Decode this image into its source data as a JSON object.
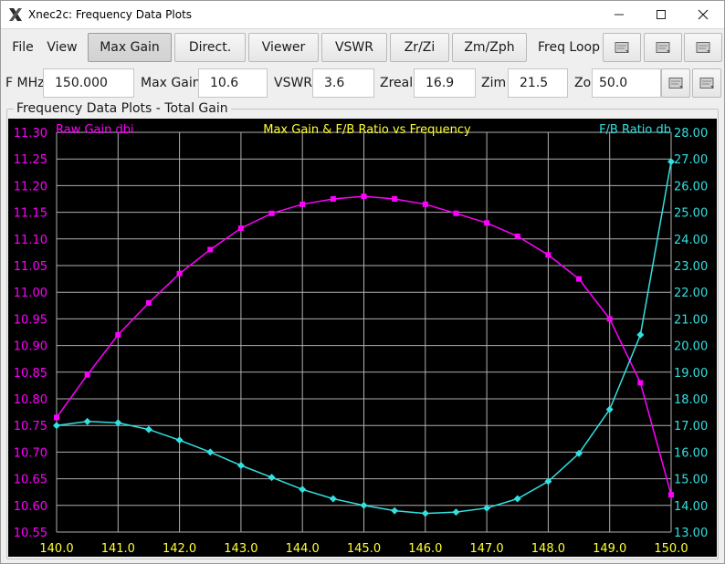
{
  "window": {
    "title": "Xnec2c: Frequency Data Plots"
  },
  "toolbar": {
    "file_label": "File",
    "view_label": "View",
    "max_gain_label": "Max Gain",
    "direct_label": "Direct.",
    "viewer_label": "Viewer",
    "vswr_label": "VSWR",
    "zrzi_label": "Zr/Zi",
    "zmzph_label": "Zm/Zph",
    "freq_loop_label": "Freq Loop"
  },
  "fields": {
    "fmhz_label": "F MHz",
    "fmhz_value": "150.000",
    "maxgain_label": "Max Gain",
    "maxgain_value": "10.6",
    "vswr_label": "VSWR",
    "vswr_value": "3.6",
    "zreal_label": "Zreal",
    "zreal_value": "16.9",
    "zim_label": "Zim",
    "zim_value": "21.5",
    "zo_label": "Zo",
    "zo_value": "50.0"
  },
  "group": {
    "label": "Frequency Data Plots - Total Gain"
  },
  "colors": {
    "gain": "#ff00ff",
    "ratio": "#33e0e0",
    "title": "#ffff33",
    "grid": "#b0b0b0",
    "xticks": "#ffff33"
  },
  "chart_data": {
    "type": "line",
    "title": "Max Gain & F/B Ratio vs Frequency",
    "xlim": [
      140.0,
      150.0
    ],
    "x_ticks": [
      "140.0",
      "141.0",
      "142.0",
      "143.0",
      "144.0",
      "145.0",
      "146.0",
      "147.0",
      "148.0",
      "149.0",
      "150.0"
    ],
    "y_left": {
      "label": "Raw Gain dbi",
      "ylim": [
        10.55,
        11.3
      ],
      "ticks": [
        "11.30",
        "11.25",
        "11.20",
        "11.15",
        "11.10",
        "11.05",
        "11.00",
        "10.95",
        "10.90",
        "10.85",
        "10.80",
        "10.75",
        "10.70",
        "10.65",
        "10.60",
        "10.55"
      ]
    },
    "y_right": {
      "label": "F/B Ratio db",
      "ylim": [
        13.0,
        28.0
      ],
      "ticks": [
        "28.00",
        "27.00",
        "26.00",
        "25.00",
        "24.00",
        "23.00",
        "22.00",
        "21.00",
        "20.00",
        "19.00",
        "18.00",
        "17.00",
        "16.00",
        "15.00",
        "14.00",
        "13.00"
      ]
    },
    "grid": true,
    "x": [
      140.0,
      140.5,
      141.0,
      141.5,
      142.0,
      142.5,
      143.0,
      143.5,
      144.0,
      144.5,
      145.0,
      145.5,
      146.0,
      146.5,
      147.0,
      147.5,
      148.0,
      148.5,
      149.0,
      149.5,
      150.0
    ],
    "series": [
      {
        "name": "Raw Gain dbi",
        "axis": "left",
        "values": [
          10.765,
          10.845,
          10.92,
          10.98,
          11.035,
          11.08,
          11.12,
          11.148,
          11.165,
          11.175,
          11.18,
          11.175,
          11.165,
          11.148,
          11.13,
          11.105,
          11.07,
          11.025,
          10.95,
          10.83,
          10.62
        ]
      },
      {
        "name": "F/B Ratio db",
        "axis": "right",
        "values": [
          17.0,
          17.15,
          17.1,
          16.85,
          16.45,
          16.0,
          15.5,
          15.05,
          14.6,
          14.25,
          14.0,
          13.8,
          13.7,
          13.75,
          13.9,
          14.25,
          14.9,
          15.95,
          17.6,
          20.4,
          26.9
        ]
      }
    ]
  }
}
